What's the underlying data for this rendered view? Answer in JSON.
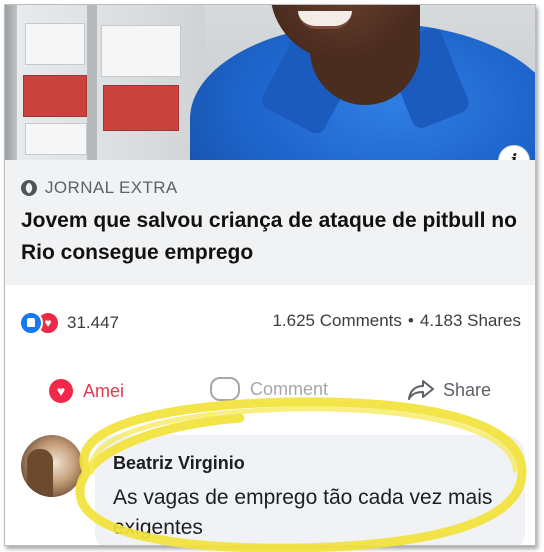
{
  "post": {
    "source": "JORNAL EXTRA",
    "headline": "Jovem que salvou criança de ataque de pitbull no Rio consegue emprego",
    "info_icon": "i"
  },
  "engagement": {
    "reaction_count": "31.447",
    "comments": "1.625 Comments",
    "separator": "•",
    "shares": "4.183 Shares"
  },
  "actions": {
    "love_label": "Amei",
    "comment_label": "Comment",
    "share_label": "Share"
  },
  "comment": {
    "author": "Beatriz Virginio",
    "text": "As vagas de emprego tão cada vez mais exigentes"
  },
  "colors": {
    "facebook_blue": "#1877f2",
    "love_red": "#f0284a",
    "highlight_yellow": "#f2e23a"
  }
}
